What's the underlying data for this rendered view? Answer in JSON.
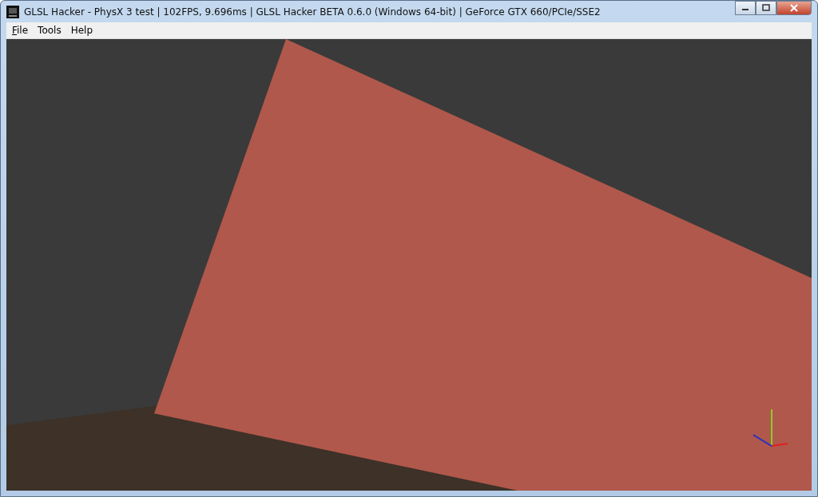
{
  "window": {
    "title": "GLSL Hacker - PhysX 3 test | 102FPS, 9.696ms | GLSL Hacker BETA 0.6.0 (Windows 64-bit) | GeForce GTX 660/PCIe/SSE2"
  },
  "menu": [
    {
      "label": "File",
      "mnemonic": true
    },
    {
      "label": "Tools",
      "mnemonic": false
    },
    {
      "label": "Help",
      "mnemonic": false
    }
  ]
}
